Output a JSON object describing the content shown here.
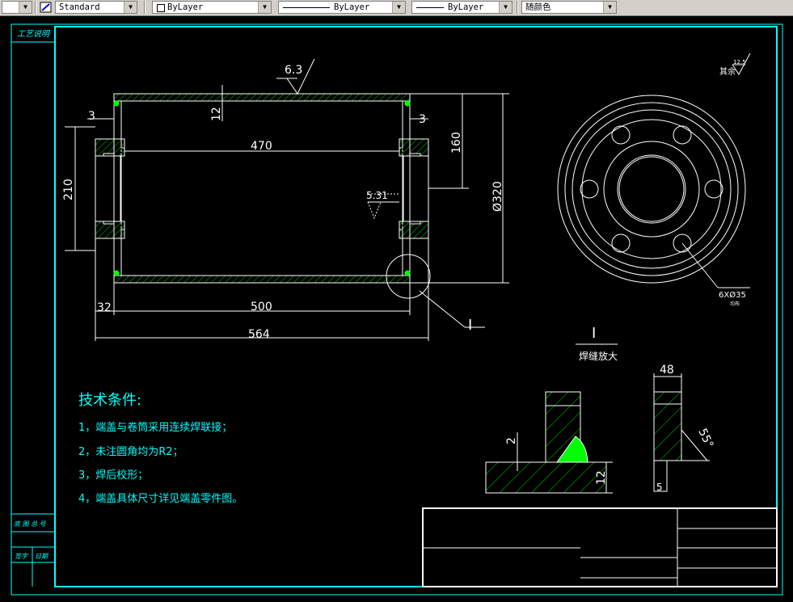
{
  "toolbar": {
    "text_style": "Standard",
    "color": "ByLayer",
    "linetype": "ByLayer",
    "lineweight": "ByLayer",
    "plot_style": "随颜色"
  },
  "title_block_side": {
    "process_label": "工艺说明",
    "row1_label": "底 图 总 号",
    "sign_label": "签字",
    "date_label": "日期"
  },
  "dimensions": {
    "surface_finish": "6.3",
    "wall_thickness": "12",
    "left_gap": "3",
    "right_gap": "3",
    "inner_length": "470",
    "flange_dia": "210",
    "half_height": "160",
    "outer_dia": "Ø320",
    "weld_spec": "5.31",
    "shell_length": "500",
    "overall_length": "564",
    "end_offset": "32",
    "detail_marker": "I",
    "roughness_other_label": "其余",
    "roughness_other_value": "12.5",
    "holes_note": "6XØ35",
    "holes_sub": "均布"
  },
  "detail": {
    "title": "I",
    "subtitle": "焊缝放大",
    "dim_2": "2",
    "dim_12": "12",
    "dim_48": "48",
    "dim_55": "55°",
    "dim_5": "5"
  },
  "notes": {
    "heading": "技术条件:",
    "items": [
      "1，端盖与卷筒采用连续焊联接；",
      "2，未注圆角均为R2；",
      "3，焊后校形；",
      "4，端盖具体尺寸详见端盖零件图。"
    ]
  },
  "colors": {
    "frame": "#00ffff",
    "geometry": "#ffffff",
    "weld": "#00ff00",
    "hatch": "#00cc00"
  }
}
